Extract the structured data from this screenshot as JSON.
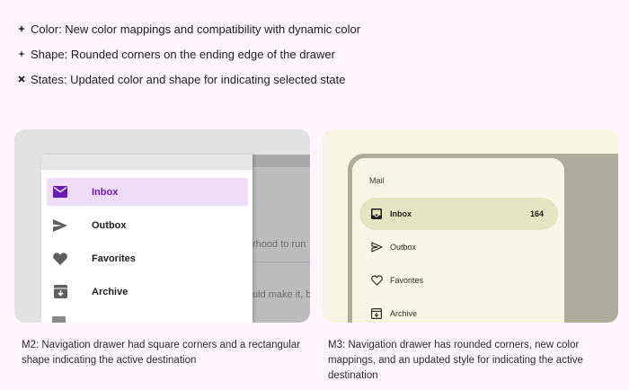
{
  "bullets": [
    {
      "icon": "star-bullet-icon",
      "text": "Color: New color mappings and compatibility with dynamic color"
    },
    {
      "icon": "sparkle-bullet-icon",
      "text": "Shape: Rounded corners on the ending edge of the drawer"
    },
    {
      "icon": "cross-bullet-icon",
      "text": "States: Updated color and shape for indicating selected state"
    }
  ],
  "m2": {
    "accent": "#6a1ab8",
    "active_bg": "#efdbfa",
    "items": [
      {
        "label": "Inbox",
        "icon": "mail-icon",
        "active": true
      },
      {
        "label": "Outbox",
        "icon": "send-icon",
        "active": false
      },
      {
        "label": "Favorites",
        "icon": "heart-icon",
        "active": false
      },
      {
        "label": "Archive",
        "icon": "archive-icon",
        "active": false
      }
    ],
    "background_texts": [
      "rhood to run",
      "uld make it, b"
    ],
    "caption": "M2: Navigation drawer had square corners and a rectangular shape indicating the active destination"
  },
  "m3": {
    "accent": "#e3e6c3",
    "headline": "Mail",
    "items": [
      {
        "label": "Inbox",
        "icon": "inbox-icon",
        "active": true,
        "badge": "164"
      },
      {
        "label": "Outbox",
        "icon": "send-outline-icon",
        "active": false
      },
      {
        "label": "Favorites",
        "icon": "heart-outline-icon",
        "active": false
      },
      {
        "label": "Archive",
        "icon": "archive-outline-icon",
        "active": false
      }
    ],
    "caption": "M3: Navigation drawer has rounded corners, new color mappings, and an updated style for indicating the active destination"
  }
}
